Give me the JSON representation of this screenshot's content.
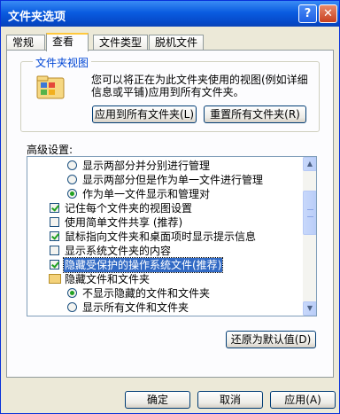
{
  "window": {
    "title": "文件夹选项"
  },
  "tabs": [
    {
      "label": "常规"
    },
    {
      "label": "查看"
    },
    {
      "label": "文件类型"
    },
    {
      "label": "脱机文件"
    }
  ],
  "folder_views": {
    "legend": "文件夹视图",
    "description": "您可以将正在为此文件夹使用的视图(例如详细信息或平铺)应用到所有文件夹。",
    "apply_button": "应用到所有文件夹(L)",
    "reset_button": "重置所有文件夹(R)"
  },
  "advanced": {
    "label": "高级设置:",
    "items": [
      {
        "type": "radio",
        "checked": false,
        "label": "显示两部分并分别进行管理"
      },
      {
        "type": "radio",
        "checked": false,
        "label": "显示两部分但是作为单一文件进行管理"
      },
      {
        "type": "radio",
        "checked": true,
        "label": "作为单一文件显示和管理对"
      },
      {
        "type": "checkbox",
        "checked": true,
        "label": "记住每个文件夹的视图设置"
      },
      {
        "type": "checkbox",
        "checked": false,
        "label": "使用简单文件共享 (推荐)"
      },
      {
        "type": "checkbox",
        "checked": true,
        "label": "鼠标指向文件夹和桌面项时显示提示信息"
      },
      {
        "type": "checkbox",
        "checked": false,
        "label": "显示系统文件夹的内容"
      },
      {
        "type": "checkbox",
        "checked": true,
        "label": "隐藏受保护的操作系统文件(推荐)"
      },
      {
        "type": "folder",
        "label": "隐藏文件和文件夹"
      },
      {
        "type": "radio",
        "checked": true,
        "label": "不显示隐藏的文件和文件夹"
      },
      {
        "type": "radio",
        "checked": false,
        "label": "显示所有文件和文件夹"
      }
    ],
    "restore_button": "还原为默认值(D)"
  },
  "footer": {
    "ok": "确定",
    "cancel": "取消",
    "apply": "应用(A)"
  }
}
